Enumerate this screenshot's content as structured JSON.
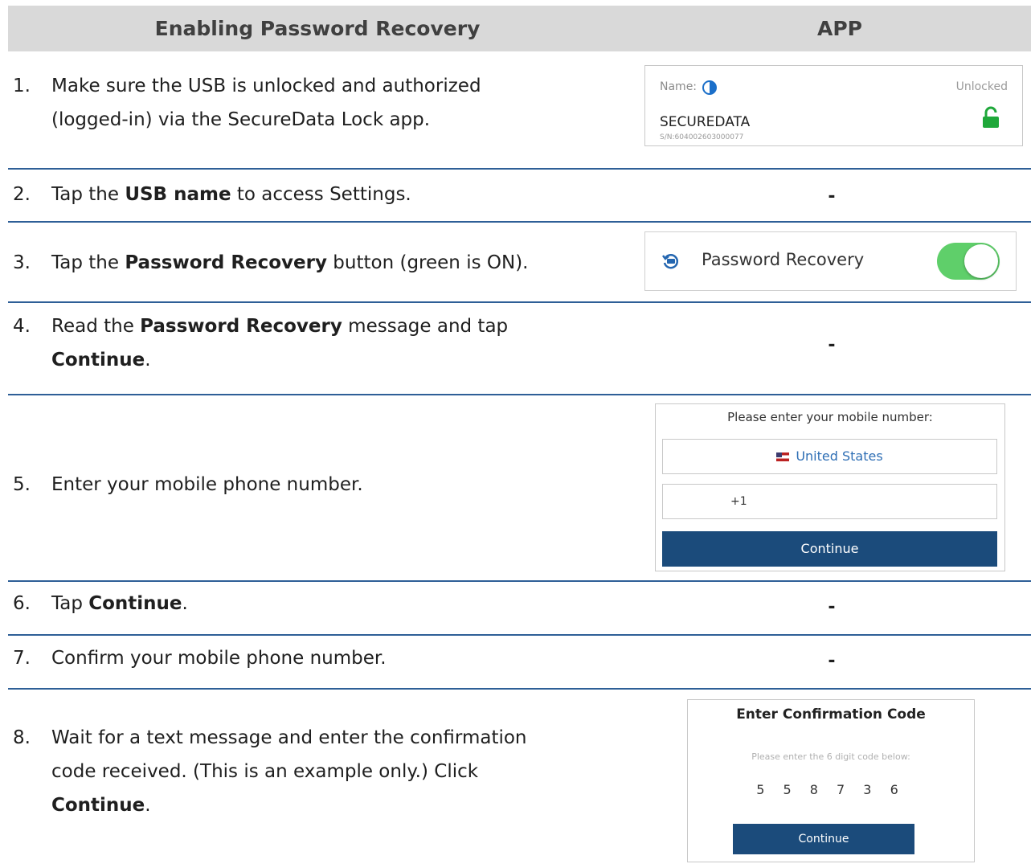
{
  "header": {
    "left": "Enabling Password Recovery",
    "right": "APP"
  },
  "steps": [
    {
      "num": "1.",
      "line1": "Make sure the USB is unlocked and authorized",
      "line2": "(logged-in) via the SecureData Lock app."
    },
    {
      "num": "2.",
      "pre": "Tap the ",
      "bold": "USB name",
      "post": " to access Settings.",
      "dash": "-"
    },
    {
      "num": "3.",
      "pre": "Tap the ",
      "bold": "Password Recovery",
      "post": " button (green is ON)."
    },
    {
      "num": "4.",
      "pre": "Read the ",
      "bold": "Password Recovery",
      "post": " message and tap",
      "line2_bold": "Continue",
      "line2_post": ".",
      "dash": "-"
    },
    {
      "num": "5.",
      "text": "Enter your mobile phone number."
    },
    {
      "num": "6.",
      "pre": "Tap ",
      "bold": "Continue",
      "post": ".",
      "dash": "-"
    },
    {
      "num": "7.",
      "text": "Confirm your mobile phone number.",
      "dash": "-"
    },
    {
      "num": "8.",
      "line1": "Wait for a text message and enter the confirmation",
      "line2": "code received. (This is an example only.) Click",
      "line3_bold": "Continue",
      "line3_post": "."
    }
  ],
  "app1": {
    "name_label": "Name:",
    "status": "Unlocked",
    "device": "SECUREDATA",
    "serial": "S/N:604002603000077"
  },
  "app3": {
    "label": "Password Recovery",
    "toggle_on": true,
    "toggle_color": "#5fcf6a"
  },
  "app5": {
    "prompt": "Please enter your mobile number:",
    "country": "United States",
    "phone_prefix": "+1",
    "button": "Continue"
  },
  "app8": {
    "title": "Enter Confirmation Code",
    "subtitle": "Please enter the 6 digit code below:",
    "code": "5 5 8 7 3 6",
    "button": "Continue"
  },
  "colors": {
    "rule": "#2e5f97",
    "header_bg": "#d9d9d9",
    "button": "#1b4b7b"
  }
}
